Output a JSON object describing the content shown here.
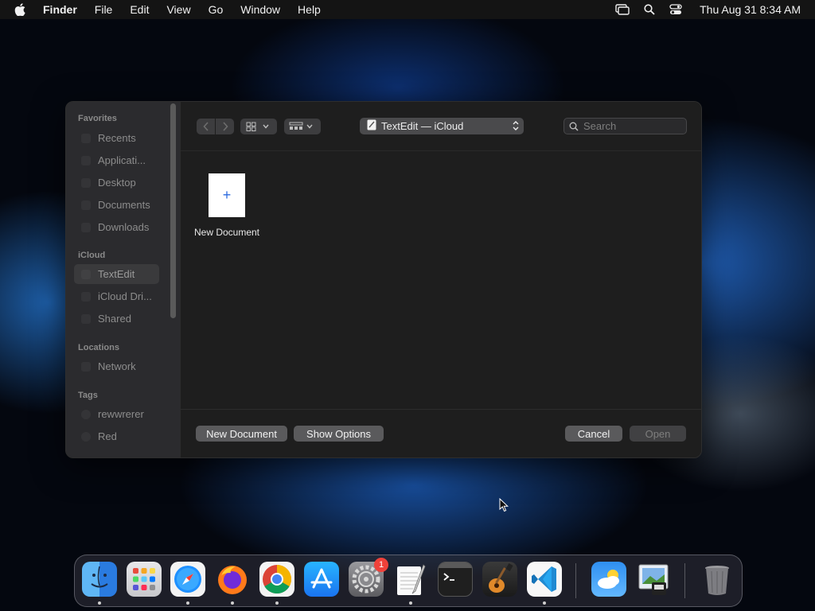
{
  "menubar": {
    "app_name": "Finder",
    "items": [
      "File",
      "Edit",
      "View",
      "Go",
      "Window",
      "Help"
    ],
    "clock": "Thu Aug 31  8:34 AM"
  },
  "sidebar": {
    "favorites_header": "Favorites",
    "favorites": [
      "Recents",
      "Applicati...",
      "Desktop",
      "Documents",
      "Downloads"
    ],
    "icloud_header": "iCloud",
    "icloud": [
      "TextEdit",
      "iCloud Dri...",
      "Shared"
    ],
    "locations_header": "Locations",
    "locations": [
      "Network"
    ],
    "tags_header": "Tags",
    "tags": [
      "rewwrerer",
      "Red"
    ]
  },
  "toolbar": {
    "location": "TextEdit — iCloud",
    "search_placeholder": "Search"
  },
  "content": {
    "tile_plus": "+",
    "tile_label": "New Document"
  },
  "buttons": {
    "new_document": "New Document",
    "show_options": "Show Options",
    "cancel": "Cancel",
    "open": "Open"
  },
  "dock": {
    "settings_badge": "1",
    "apps": [
      "finder-icon",
      "launchpad-icon",
      "safari-icon",
      "firefox-icon",
      "chrome-icon",
      "app-store-icon",
      "system-settings-icon",
      "textedit-icon",
      "terminal-icon",
      "garageband-icon",
      "vscode-icon",
      "weather-icon",
      "preview-icon",
      "trash-icon"
    ]
  },
  "colors": {
    "accent": "#2d6be0",
    "dialog_bg": "#1e1e1e",
    "badge": "#f0413a"
  }
}
